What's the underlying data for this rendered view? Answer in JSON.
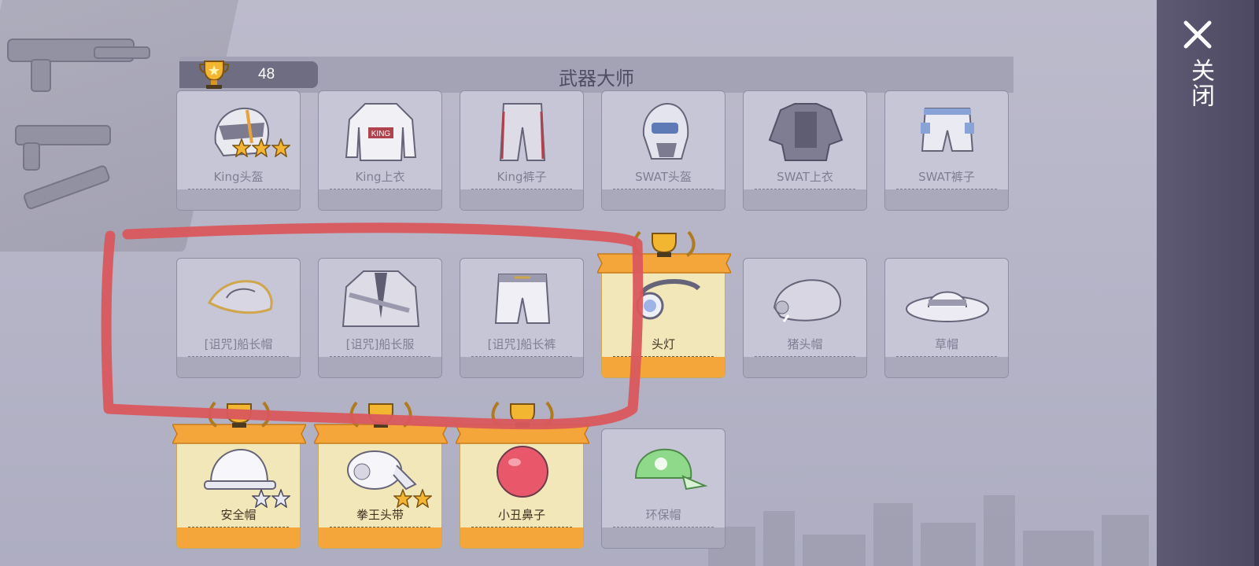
{
  "header": {
    "title": "武器大师",
    "trophy_count": "48"
  },
  "close": {
    "label": "关闭"
  },
  "colors": {
    "annotation": "#d9585d",
    "gold_card": "#f1e7b9",
    "gold_footer": "#f4a63a",
    "grey_card": "#c7c6d6",
    "panel": "#54506b"
  },
  "items": [
    {
      "name": "King头盔",
      "icon": "helmet-icon",
      "unlocked": false,
      "stars": 3
    },
    {
      "name": "King上衣",
      "icon": "jacket-icon",
      "unlocked": false,
      "stars": 0
    },
    {
      "name": "King裤子",
      "icon": "pants-icon",
      "unlocked": false,
      "stars": 0
    },
    {
      "name": "SWAT头盔",
      "icon": "swat-helmet-icon",
      "unlocked": false,
      "stars": 0
    },
    {
      "name": "SWAT上衣",
      "icon": "vest-icon",
      "unlocked": false,
      "stars": 0
    },
    {
      "name": "SWAT裤子",
      "icon": "swat-pants-icon",
      "unlocked": false,
      "stars": 0
    },
    {
      "name": "[诅咒]船长帽",
      "icon": "tricorn-hat-icon",
      "unlocked": false,
      "stars": 0
    },
    {
      "name": "[诅咒]船长服",
      "icon": "captain-coat-icon",
      "unlocked": false,
      "stars": 0
    },
    {
      "name": "[诅咒]船长裤",
      "icon": "captain-pants-icon",
      "unlocked": false,
      "stars": 0
    },
    {
      "name": "头灯",
      "icon": "headlamp-icon",
      "unlocked": true,
      "stars": 0
    },
    {
      "name": "猪头帽",
      "icon": "boar-head-icon",
      "unlocked": false,
      "stars": 0
    },
    {
      "name": "草帽",
      "icon": "straw-hat-icon",
      "unlocked": false,
      "stars": 0
    },
    {
      "name": "安全帽",
      "icon": "hard-hat-icon",
      "unlocked": true,
      "stars": 2,
      "stars_filled": 0
    },
    {
      "name": "拳王头带",
      "icon": "headband-icon",
      "unlocked": true,
      "stars": 2,
      "stars_filled": 2
    },
    {
      "name": "小丑鼻子",
      "icon": "clown-nose-icon",
      "unlocked": true,
      "stars": 0
    },
    {
      "name": "环保帽",
      "icon": "green-cap-icon",
      "unlocked": false,
      "stars": 0
    }
  ]
}
